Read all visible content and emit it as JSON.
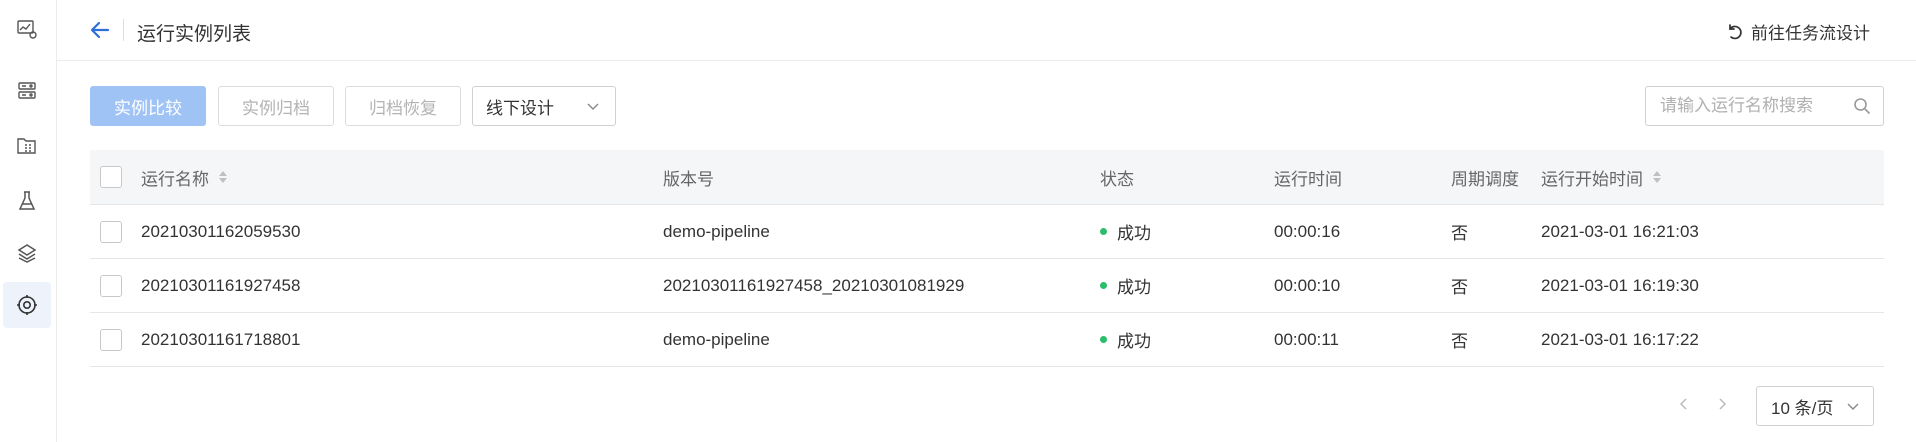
{
  "sidebar": {
    "items": [
      {
        "icon": "monitor-settings-icon",
        "active": false
      },
      {
        "icon": "server-config-icon",
        "active": false
      },
      {
        "icon": "folder-grid-icon",
        "active": false
      },
      {
        "icon": "flask-icon",
        "active": false
      },
      {
        "icon": "layers-icon",
        "active": false
      },
      {
        "icon": "gear-icon",
        "active": true
      }
    ]
  },
  "header": {
    "title": "运行实例列表",
    "goto_label": "前往任务流设计"
  },
  "toolbar": {
    "compare_label": "实例比较",
    "archive_label": "实例归档",
    "restore_label": "归档恢复",
    "select_value": "线下设计",
    "search_placeholder": "请输入运行名称搜索"
  },
  "table": {
    "columns": [
      "运行名称",
      "版本号",
      "状态",
      "运行时间",
      "周期调度",
      "运行开始时间"
    ],
    "rows": [
      {
        "name": "20210301162059530",
        "version": "demo-pipeline",
        "status": "成功",
        "duration": "00:00:16",
        "periodic": "否",
        "start": "2021-03-01 16:21:03"
      },
      {
        "name": "20210301161927458",
        "version": "20210301161927458_20210301081929",
        "status": "成功",
        "duration": "00:00:10",
        "periodic": "否",
        "start": "2021-03-01 16:19:30"
      },
      {
        "name": "20210301161718801",
        "version": "demo-pipeline",
        "status": "成功",
        "duration": "00:00:11",
        "periodic": "否",
        "start": "2021-03-01 16:17:22"
      }
    ]
  },
  "pager": {
    "size_label": "10 条/页"
  },
  "colors": {
    "accent": "#2d6fd6",
    "primary_disabled": "#9fc3f5",
    "success": "#2bbd6c"
  }
}
